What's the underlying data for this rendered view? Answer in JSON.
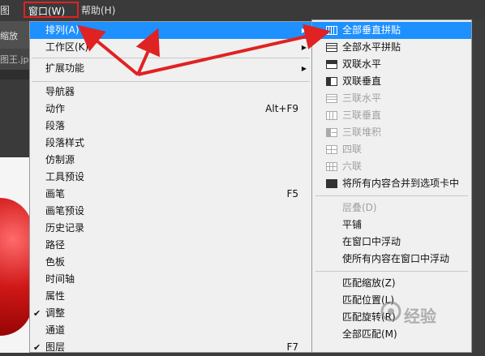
{
  "menubar": {
    "partial_item": "图",
    "window_menu": "窗口(W)",
    "help_menu": "帮助(H)"
  },
  "app": {
    "toolbar_text": "缩放",
    "tab_text": "图王.jp"
  },
  "menu": {
    "items": [
      {
        "label": "排列(A)",
        "shortcut": "",
        "submenu": true,
        "checked": false,
        "highlighted": true
      },
      {
        "label": "工作区(K)",
        "shortcut": "",
        "submenu": true,
        "checked": false
      },
      {
        "label": "扩展功能",
        "shortcut": "",
        "submenu": true,
        "checked": false
      },
      {
        "label": "导航器",
        "shortcut": "",
        "checked": false
      },
      {
        "label": "动作",
        "shortcut": "Alt+F9",
        "checked": false
      },
      {
        "label": "段落",
        "shortcut": "",
        "checked": false
      },
      {
        "label": "段落样式",
        "shortcut": "",
        "checked": false
      },
      {
        "label": "仿制源",
        "shortcut": "",
        "checked": false
      },
      {
        "label": "工具预设",
        "shortcut": "",
        "checked": false
      },
      {
        "label": "画笔",
        "shortcut": "F5",
        "checked": false
      },
      {
        "label": "画笔预设",
        "shortcut": "",
        "checked": false
      },
      {
        "label": "历史记录",
        "shortcut": "",
        "checked": false
      },
      {
        "label": "路径",
        "shortcut": "",
        "checked": false
      },
      {
        "label": "色板",
        "shortcut": "",
        "checked": false
      },
      {
        "label": "时间轴",
        "shortcut": "",
        "checked": false
      },
      {
        "label": "属性",
        "shortcut": "",
        "checked": false
      },
      {
        "label": "调整",
        "shortcut": "",
        "checked": true
      },
      {
        "label": "通道",
        "shortcut": "",
        "checked": false
      },
      {
        "label": "图层",
        "shortcut": "F7",
        "checked": true
      }
    ],
    "check_glyph": "✔",
    "arrow_glyph": "▶"
  },
  "submenu": {
    "items": [
      {
        "label": "全部垂直拼贴",
        "icon": "tile-vertical-icon",
        "enabled": true,
        "highlighted": true
      },
      {
        "label": "全部水平拼贴",
        "icon": "tile-horizontal-icon",
        "enabled": true
      },
      {
        "label": "双联水平",
        "icon": "two-up-horizontal-icon",
        "enabled": true
      },
      {
        "label": "双联垂直",
        "icon": "two-up-vertical-icon",
        "enabled": true
      },
      {
        "label": "三联水平",
        "icon": "three-up-horizontal-icon",
        "enabled": false
      },
      {
        "label": "三联垂直",
        "icon": "three-up-vertical-icon",
        "enabled": false
      },
      {
        "label": "三联堆积",
        "icon": "three-up-stacked-icon",
        "enabled": false
      },
      {
        "label": "四联",
        "icon": "four-up-icon",
        "enabled": false
      },
      {
        "label": "六联",
        "icon": "six-up-icon",
        "enabled": false
      },
      {
        "label": "将所有内容合并到选项卡中",
        "icon": "consolidate-tabs-icon",
        "enabled": true
      },
      {
        "label": "层叠(D)",
        "enabled": false
      },
      {
        "label": "平铺",
        "enabled": true
      },
      {
        "label": "在窗口中浮动",
        "enabled": true
      },
      {
        "label": "使所有内容在窗口中浮动",
        "enabled": true
      },
      {
        "label": "匹配缩放(Z)",
        "enabled": true
      },
      {
        "label": "匹配位置(L)",
        "enabled": true
      },
      {
        "label": "匹配旋转(R)",
        "enabled": true
      },
      {
        "label": "全部匹配(M)",
        "enabled": true
      }
    ]
  },
  "watermark": {
    "text": "经验"
  },
  "colors": {
    "highlight": "#1e90ff",
    "annotation": "#e02222",
    "menu_bg": "#f0f0f0"
  }
}
